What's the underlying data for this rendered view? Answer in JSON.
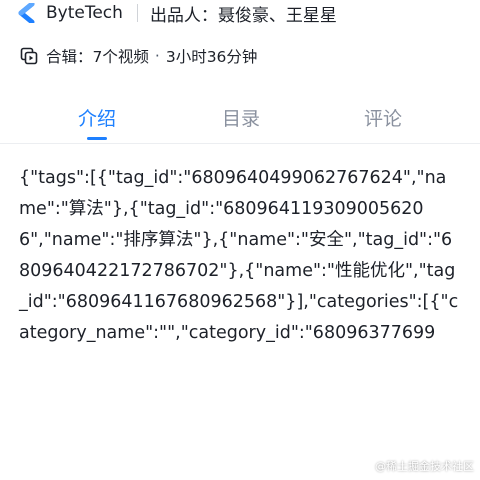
{
  "header": {
    "brand": "ByteTech",
    "author_label": "出品人：",
    "author_names": "聂俊豪、王星星"
  },
  "collection": {
    "label": "合辑：",
    "video_count": "7个视频",
    "separator": "·",
    "duration": "3小时36分钟"
  },
  "tabs": [
    {
      "label": "介绍",
      "active": true
    },
    {
      "label": "目录",
      "active": false
    },
    {
      "label": "评论",
      "active": false
    }
  ],
  "content": {
    "json_text": "{\"tags\":[{\"tag_id\":\"6809640499062767624\",\"name\":\"算法\"},{\"tag_id\":\"6809641193090056206\",\"name\":\"排序算法\"},{\"name\":\"安全\",\"tag_id\":\"6809640422172786702\"},{\"name\":\"性能优化\",\"tag_id\":\"6809641167680962568\"}],\"categories\":[{\"category_name\":\"\",\"category_id\":\"68096377699"
  },
  "watermark": "@稀土掘金技术社区",
  "colors": {
    "accent": "#1e80ff",
    "text": "#1d2129",
    "muted": "#8a919f"
  },
  "icons": {
    "brand": "bytetech-logo-icon",
    "collection": "video-collection-icon"
  }
}
